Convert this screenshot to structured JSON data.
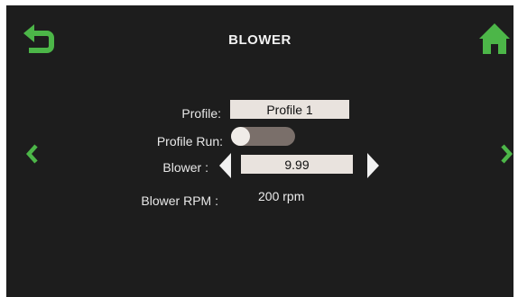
{
  "header": {
    "title": "BLOWER"
  },
  "icons": {
    "back": "back-arrow-icon",
    "home": "home-icon",
    "prev": "chevron-left-icon",
    "next": "chevron-right-icon",
    "decrease": "triangle-left-icon",
    "increase": "triangle-right-icon"
  },
  "colors": {
    "accent_green": "#4cb648",
    "screen_background": "#1d1d1d",
    "field_background": "#e9e3de",
    "toggle_track": "#7a6f6a"
  },
  "form": {
    "profile": {
      "label": "Profile:",
      "value": "Profile 1"
    },
    "profile_run": {
      "label": "Profile Run:",
      "state": "off"
    },
    "blower": {
      "label": "Blower :",
      "value": "9.99"
    },
    "blower_rpm": {
      "label": "Blower RPM :",
      "value": "200 rpm"
    }
  }
}
